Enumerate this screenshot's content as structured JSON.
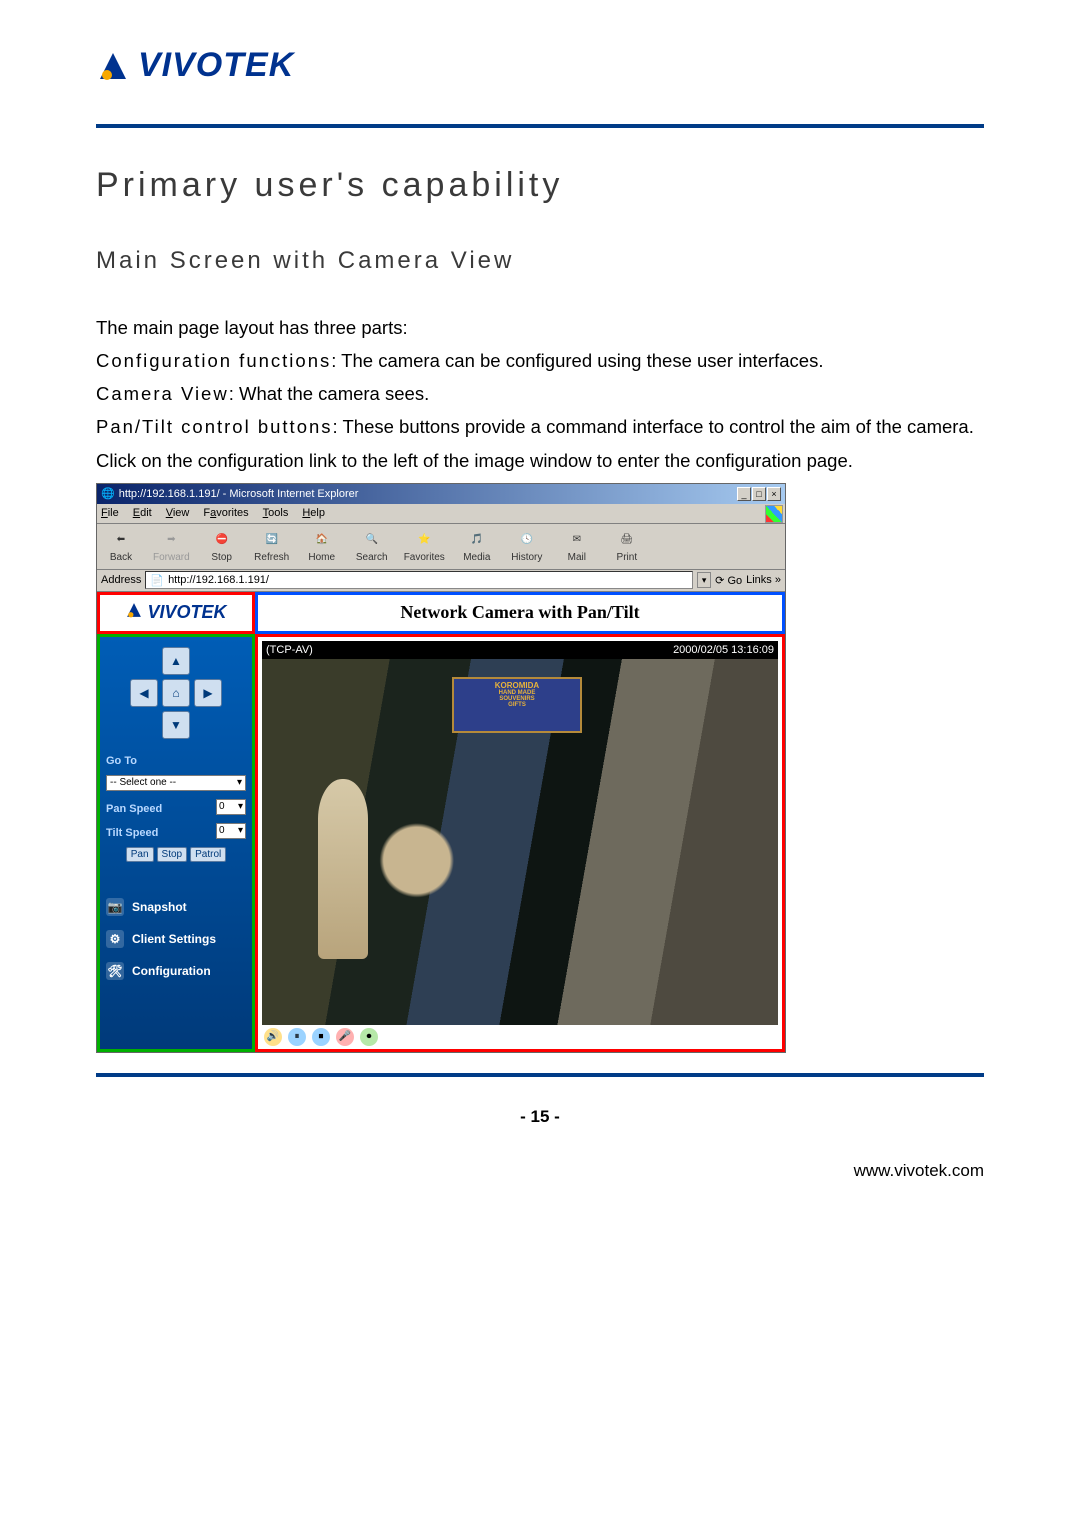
{
  "header": {
    "logo_text": "VIVOTEK"
  },
  "doc": {
    "h1": "Primary user's capability",
    "h2": "Main Screen with Camera View",
    "p1": "The main page layout has three parts:",
    "term1": "Configuration functions",
    "desc1": ": The camera can be configured using these user interfaces.",
    "term2": "Camera View",
    "desc2": ": What the camera sees.",
    "term3": "Pan/Tilt control buttons",
    "desc3": ": These buttons provide a command interface to control the aim of the camera.",
    "p2": "Click on the configuration link to the left of the image window to enter the configuration page."
  },
  "ie": {
    "title": "http://192.168.1.191/ - Microsoft Internet Explorer",
    "menu": {
      "file": "File",
      "edit": "Edit",
      "view": "View",
      "favorites": "Favorites",
      "tools": "Tools",
      "help": "Help"
    },
    "toolbar": {
      "back": "Back",
      "forward": "Forward",
      "stop": "Stop",
      "refresh": "Refresh",
      "home": "Home",
      "search": "Search",
      "favorites": "Favorites",
      "media": "Media",
      "history": "History",
      "mail": "Mail",
      "print": "Print"
    },
    "addr_label": "Address",
    "addr_value": "http://192.168.1.191/",
    "go": "Go",
    "links": "Links"
  },
  "cam": {
    "logo_text": "VIVOTEK",
    "title": "Network Camera with Pan/Tilt",
    "stream_label": "(TCP-AV)",
    "timestamp": "2000/02/05 13:16:09",
    "sign_line1": "KOROMIDA",
    "sign_line2": "HAND MADE",
    "sign_line3": "SOUVENIRS",
    "sign_line4": "GIFTS",
    "sidebar": {
      "goto": "Go To",
      "select_placeholder": "-- Select one --",
      "pan_speed": "Pan Speed",
      "tilt_speed": "Tilt Speed",
      "pan_val": "0",
      "tilt_val": "0",
      "btn_pan": "Pan",
      "btn_stop": "Stop",
      "btn_patrol": "Patrol",
      "link_snapshot": "Snapshot",
      "link_client": "Client Settings",
      "link_config": "Configuration"
    }
  },
  "footer": {
    "page_num": "- 15 -",
    "url": "www.vivotek.com"
  }
}
